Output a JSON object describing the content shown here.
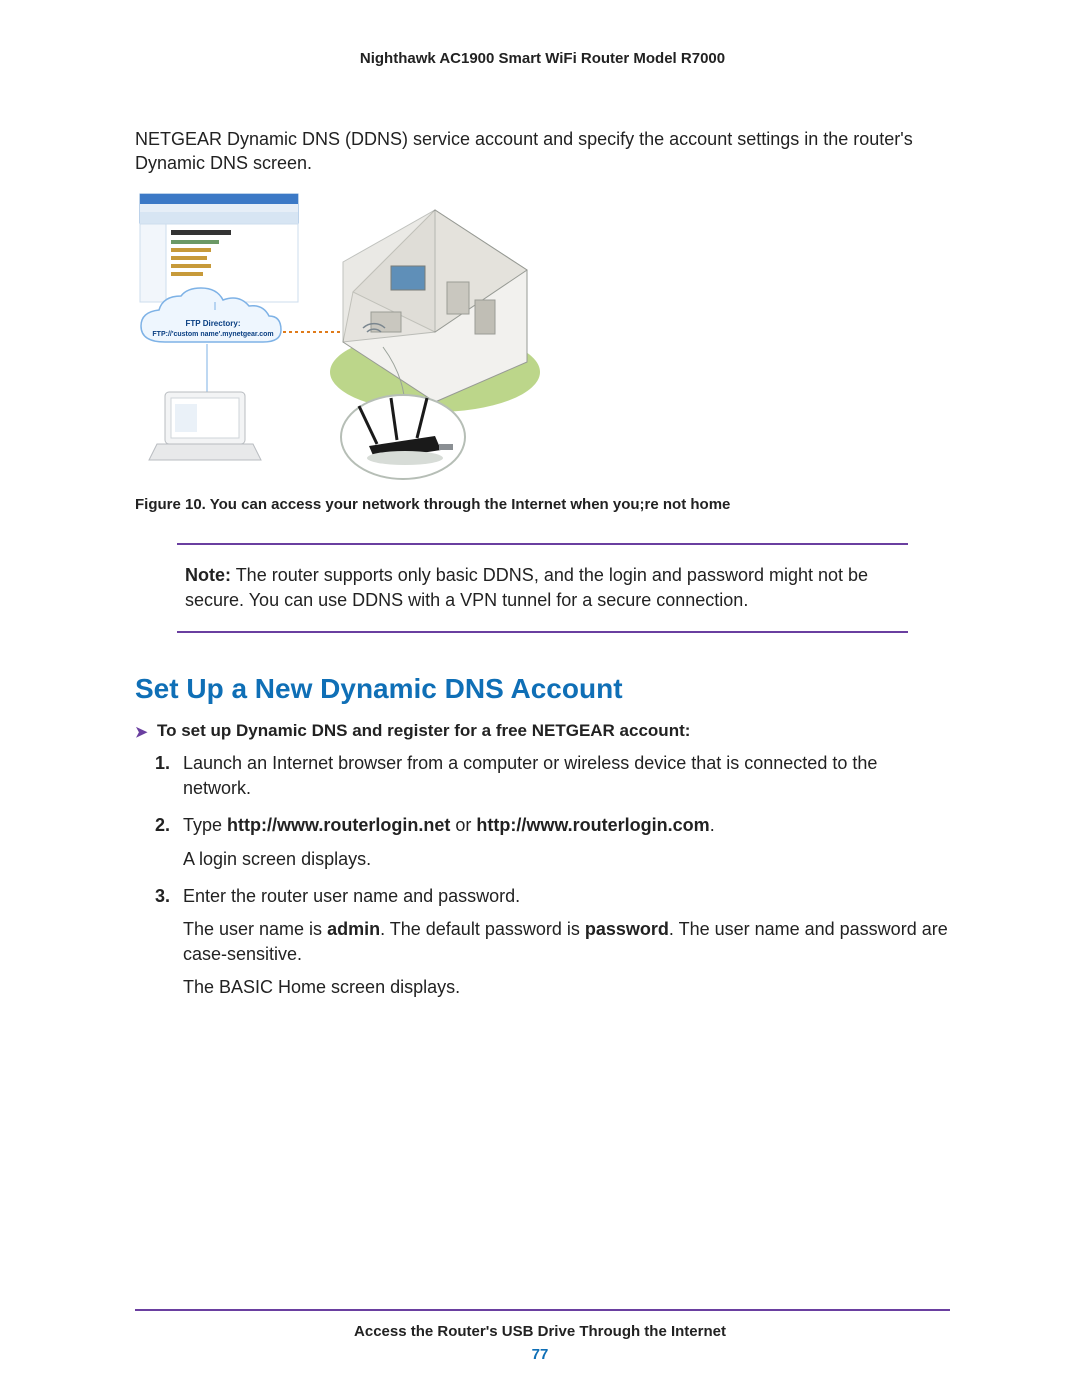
{
  "running_head": "Nighthawk AC1900 Smart WiFi Router Model R7000",
  "intro": "NETGEAR Dynamic DNS (DDNS) service account and specify the account settings in the router's Dynamic DNS screen.",
  "figure": {
    "cloud_line1": "FTP Directory:",
    "cloud_line2": "FTP://'custom name'.mynetgear.com",
    "caption": "Figure 10. You can access your network through the Internet when you;re not home"
  },
  "note": {
    "label": "Note:",
    "text": "The router supports only basic DDNS, and the login and password might not be secure. You can use DDNS with a VPN tunnel for a secure connection."
  },
  "heading": "Set Up a New Dynamic DNS Account",
  "procedure_title": "To set up Dynamic DNS and register for a free NETGEAR account:",
  "steps": {
    "s1": "Launch an Internet browser from a computer or wireless device that is connected to the network.",
    "s2_a": "Type ",
    "s2_b": "http://www.routerlogin.net",
    "s2_c": " or ",
    "s2_d": "http://www.routerlogin.com",
    "s2_e": ".",
    "s2_p": "A login screen displays.",
    "s3": "Enter the router user name and password.",
    "s3_p1_a": "The user name is ",
    "s3_p1_b": "admin",
    "s3_p1_c": ". The default password is ",
    "s3_p1_d": "password",
    "s3_p1_e": ". The user name and password are case-sensitive.",
    "s3_p2": "The BASIC Home screen displays."
  },
  "footer": {
    "title": "Access the Router's USB Drive Through the Internet",
    "page": "77"
  }
}
